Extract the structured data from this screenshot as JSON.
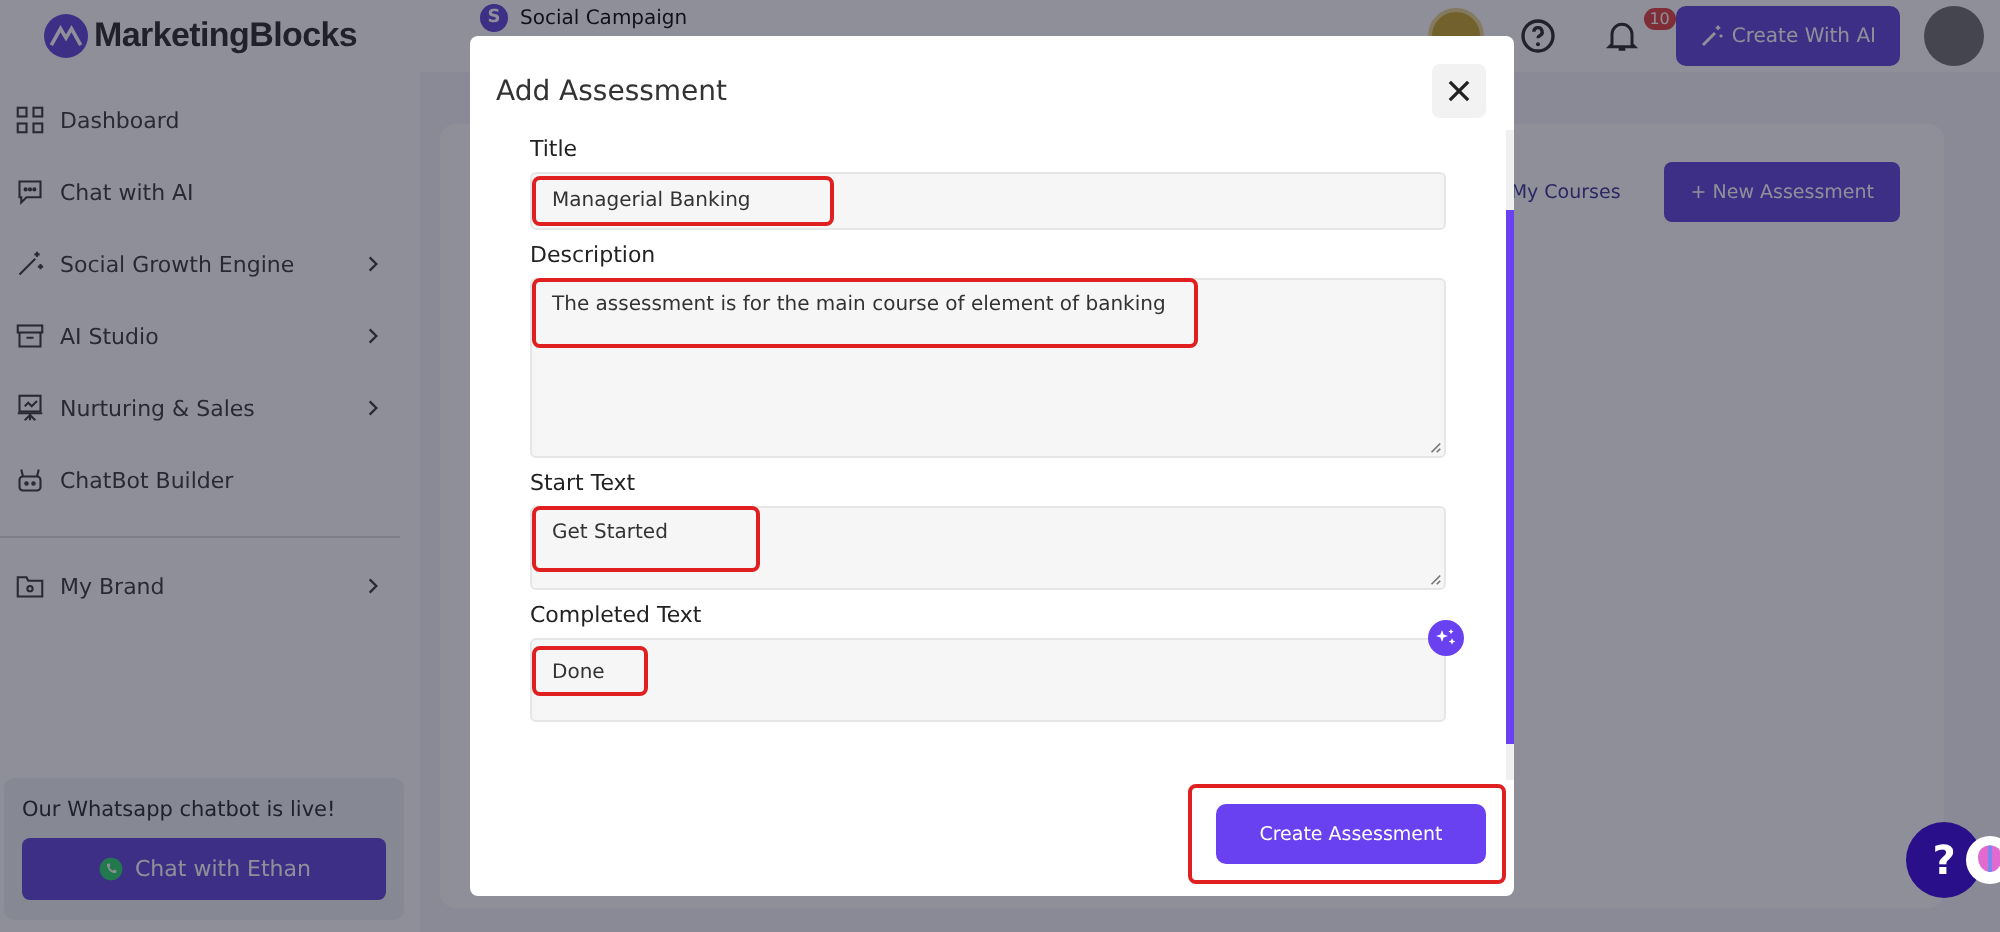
{
  "header": {
    "logo": "MarketingBlocks",
    "workspace": {
      "initial": "S",
      "name": "Social Campaign"
    },
    "notifications": "10",
    "create_button": "Create With AI"
  },
  "sidebar": {
    "items": [
      {
        "label": "Dashboard",
        "has_submenu": false
      },
      {
        "label": "Chat with AI",
        "has_submenu": false
      },
      {
        "label": "Social Growth Engine",
        "has_submenu": true
      },
      {
        "label": "AI Studio",
        "has_submenu": true
      },
      {
        "label": "Nurturing & Sales",
        "has_submenu": true
      },
      {
        "label": "ChatBot Builder",
        "has_submenu": false
      }
    ],
    "brand_item": {
      "label": "My Brand",
      "has_submenu": true
    },
    "promo": {
      "text": "Our Whatsapp chatbot is live!",
      "button": "Chat with Ethan"
    }
  },
  "content": {
    "tab": "My Courses",
    "new_button": "+ New Assessment"
  },
  "modal": {
    "title": "Add Assessment",
    "fields": [
      {
        "label": "Title",
        "kind": "line",
        "value": "Managerial Banking",
        "highlighted": true
      },
      {
        "label": "Description",
        "kind": "area",
        "value": "The assessment is for the main course of element of banking",
        "highlighted": true
      },
      {
        "label": "Start Text",
        "kind": "short",
        "value": "Get Started",
        "highlighted": true
      },
      {
        "label": "Completed Text",
        "kind": "cut",
        "value": "Done",
        "highlighted": true
      }
    ],
    "submit": {
      "label": "Create Assessment",
      "highlighted": true
    }
  },
  "help_button": "?"
}
